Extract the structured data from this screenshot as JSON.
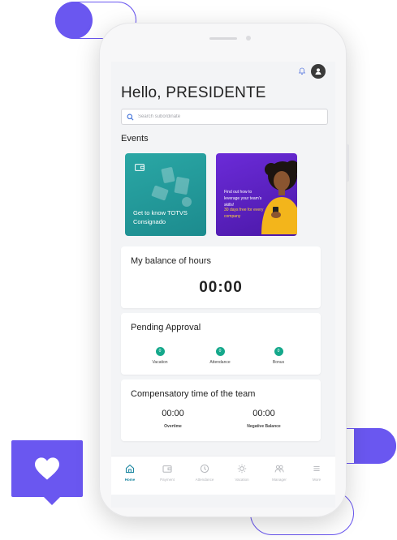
{
  "colors": {
    "accent": "#6a57f0",
    "teal": "#1b86a0",
    "status_green": "#15a88b",
    "card_teal": "#2aa7a5",
    "card_purple": "#5b22c4",
    "highlight_yellow": "#ffd339"
  },
  "header": {
    "greeting": "Hello, PRESIDENTE",
    "notification_icon": "bell-icon",
    "avatar_icon": "user-icon"
  },
  "search": {
    "placeholder": "Search subordinate"
  },
  "events": {
    "title": "Events",
    "cards": [
      {
        "text": "Get to know TOTVS Consignado",
        "icon": "wallet-icon"
      },
      {
        "text": "Find out how to leverage your team's skills!",
        "highlight": "30 days free for every company"
      }
    ]
  },
  "balance": {
    "title": "My balance of hours",
    "value": "00:00"
  },
  "pending": {
    "title": "Pending Approval",
    "items": [
      {
        "label": "Vacation",
        "count": "0"
      },
      {
        "label": "Attendance",
        "count": "0"
      },
      {
        "label": "Bonus",
        "count": "0"
      }
    ]
  },
  "compensatory": {
    "title": "Compensatory time of the team",
    "items": [
      {
        "value": "00:00",
        "label": "Overtime"
      },
      {
        "value": "00:00",
        "label": "Negative Balance"
      }
    ]
  },
  "nav": {
    "items": [
      {
        "label": "Home",
        "icon": "home-icon",
        "active": true
      },
      {
        "label": "Payment",
        "icon": "wallet-icon"
      },
      {
        "label": "Attendance",
        "icon": "clock-icon"
      },
      {
        "label": "Vacation",
        "icon": "sun-icon"
      },
      {
        "label": "Manager",
        "icon": "team-icon"
      },
      {
        "label": "More",
        "icon": "menu-icon"
      }
    ]
  }
}
